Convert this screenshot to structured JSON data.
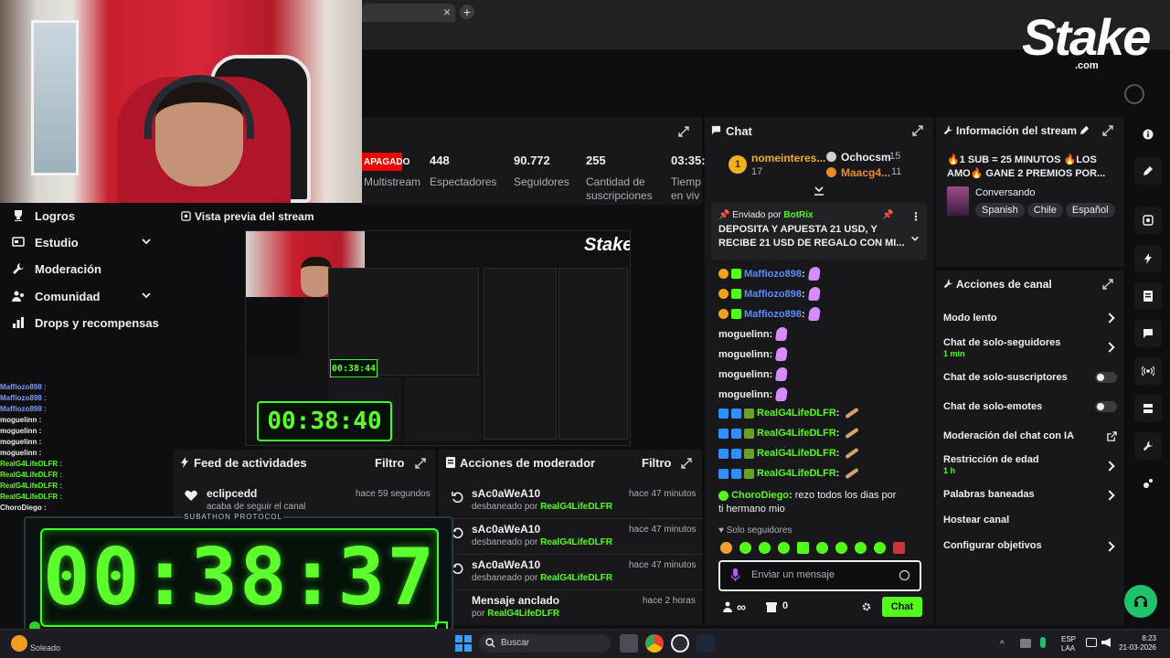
{
  "browser": {
    "tab_add": "+",
    "tab_close": "×"
  },
  "stake": {
    "logo": "Stake",
    "domain": ".com"
  },
  "stats": {
    "status_badge": "APAGADO",
    "multistream_label": "Multistream",
    "viewers_value": "448",
    "viewers_label": "Espectadores",
    "followers_value": "90.772",
    "followers_label": "Seguidores",
    "subs_value": "255",
    "subs_label_1": "Cantidad de",
    "subs_label_2": "suscripciones",
    "time_value": "03:35:",
    "time_label_1": "Tiemp",
    "time_label_2": "en viv"
  },
  "nav": {
    "items": [
      {
        "label": "Logros"
      },
      {
        "label": "Estudio"
      },
      {
        "label": "Moderación"
      },
      {
        "label": "Comunidad"
      },
      {
        "label": "Drops y recompensas"
      }
    ]
  },
  "preview": {
    "title": "Vista previa del stream",
    "inner_timer": "00:38:40",
    "tiny_timer": "00:38:44"
  },
  "feed": {
    "title": "Feed de actividades",
    "filter": "Filtro",
    "items": [
      {
        "user": "eclipcedd",
        "desc": "acaba de seguir el canal",
        "time": "hace 59 segundos"
      }
    ]
  },
  "modactions": {
    "title": "Acciones de moderador",
    "filter": "Filtro",
    "items": [
      {
        "user": "sAc0aWeA10",
        "desc": "desbaneado por",
        "by": "RealG4LifeDLFR",
        "time": "hace 47 minutos"
      },
      {
        "user": "sAc0aWeA10",
        "desc": "desbaneado por",
        "by": "RealG4LifeDLFR",
        "time": "hace 47 minutos"
      },
      {
        "user": "sAc0aWeA10",
        "desc": "desbaneado por",
        "by": "RealG4LifeDLFR",
        "time": "hace 47 minutos"
      },
      {
        "user": "Mensaje anclado",
        "desc": "por",
        "by": "RealG4LifeDLFR",
        "time": "hace 2 horas"
      }
    ]
  },
  "overlay_chat": [
    "Maffiozo898 :",
    "Maffiozo898 :",
    "Maffiozo898 :",
    "moguelinn :",
    "moguelinn :",
    "moguelinn :",
    "moguelinn :",
    "RealG4LifeDLFR :",
    "RealG4LifeDLFR :",
    "RealG4LifeDLFR :",
    "RealG4LifeDLFR :",
    "ChoroDiego :"
  ],
  "timer": {
    "label": "SUBATHON PROTOCOL",
    "value": "00:38:37"
  },
  "chat": {
    "title": "Chat",
    "top_gifters": [
      {
        "rank": "1",
        "name": "nomeinteres...",
        "count": "17"
      },
      {
        "name": "Ochocsm",
        "count": "15"
      },
      {
        "name": "Maacg4...",
        "count": "11"
      }
    ],
    "pinned": {
      "sent_by_prefix": "Enviado por",
      "sent_by": "BotRix",
      "text": "DEPOSITA Y APUESTA 21 USD, Y RECIBE 21 USD DE REGALO CON MI..."
    },
    "messages": [
      {
        "user": "Maffiozo898",
        "color": "#5b8cff"
      },
      {
        "user": "Maffiozo898",
        "color": "#5b8cff"
      },
      {
        "user": "Maffiozo898",
        "color": "#5b8cff"
      },
      {
        "user": "moguelinn",
        "color": "#efeff1"
      },
      {
        "user": "moguelinn",
        "color": "#efeff1"
      },
      {
        "user": "moguelinn",
        "color": "#efeff1"
      },
      {
        "user": "moguelinn",
        "color": "#efeff1"
      },
      {
        "user": "RealG4LifeDLFR",
        "color": "#53fc18"
      },
      {
        "user": "RealG4LifeDLFR",
        "color": "#53fc18"
      },
      {
        "user": "RealG4LifeDLFR",
        "color": "#53fc18"
      },
      {
        "user": "RealG4LifeDLFR",
        "color": "#53fc18"
      }
    ],
    "last_msg": {
      "user": "ChoroDiego",
      "text": "rezo todos los dias por ti hermano mio"
    },
    "followers_only": "Solo seguidores",
    "input_placeholder": "Enviar un mensaje",
    "infinity_count": "∞",
    "shop_count": "0",
    "send_label": "Chat"
  },
  "info": {
    "title": "Información del stream",
    "stream_title": "🔥1 SUB = 25 MINUTOS 🔥LOS AMO🔥 GANE 2 PREMIOS POR...",
    "category": "Conversando",
    "tags": [
      "Spanish",
      "Chile",
      "Español"
    ]
  },
  "actions": {
    "title": "Acciones de canal",
    "items": [
      {
        "label": "Modo lento",
        "sub": ""
      },
      {
        "label": "Chat de solo-seguidores",
        "sub": "1 min"
      },
      {
        "label": "Chat de solo-suscriptores",
        "sub": ""
      },
      {
        "label": "Chat de solo-emotes",
        "sub": ""
      },
      {
        "label": "Moderación del chat con IA",
        "sub": ""
      },
      {
        "label": "Restricción de edad",
        "sub": "1 h"
      },
      {
        "label": "Palabras baneadas",
        "sub": ""
      },
      {
        "label": "Hostear canal",
        "sub": ""
      },
      {
        "label": "Configurar objetivos",
        "sub": ""
      }
    ]
  },
  "taskbar": {
    "weather": "Soleado",
    "search_placeholder": "Buscar",
    "lang_1": "ESP",
    "lang_2": "LAA",
    "time": "8:23",
    "date": "21-03-2026"
  },
  "colors": {
    "accent": "#53fc18",
    "background": "#0e0e10",
    "panel": "#18181b",
    "status_red": "#eb0400"
  }
}
